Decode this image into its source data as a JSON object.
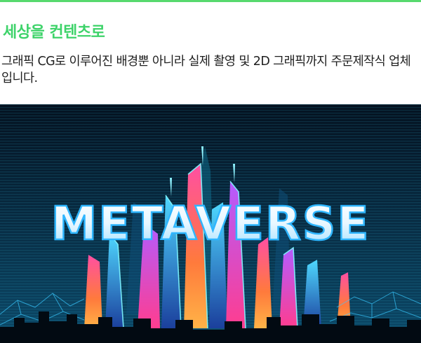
{
  "section": {
    "title": "세상을 컨텐츠로",
    "description": "그래픽 CG로 이루어진 배경뿐 아니라 실제 촬영 및 2D 그래픽까지 주문제작식 업체입니다."
  },
  "hero_image": {
    "headline": "METAVERSE",
    "subject": "neon city skyline"
  },
  "colors": {
    "accent_green": "#3ed36a",
    "top_rule": "#57d96e",
    "body_text": "#1f1f1f",
    "hero_sky_top": "#04111f",
    "hero_sky_bottom": "#0b4a6a"
  }
}
